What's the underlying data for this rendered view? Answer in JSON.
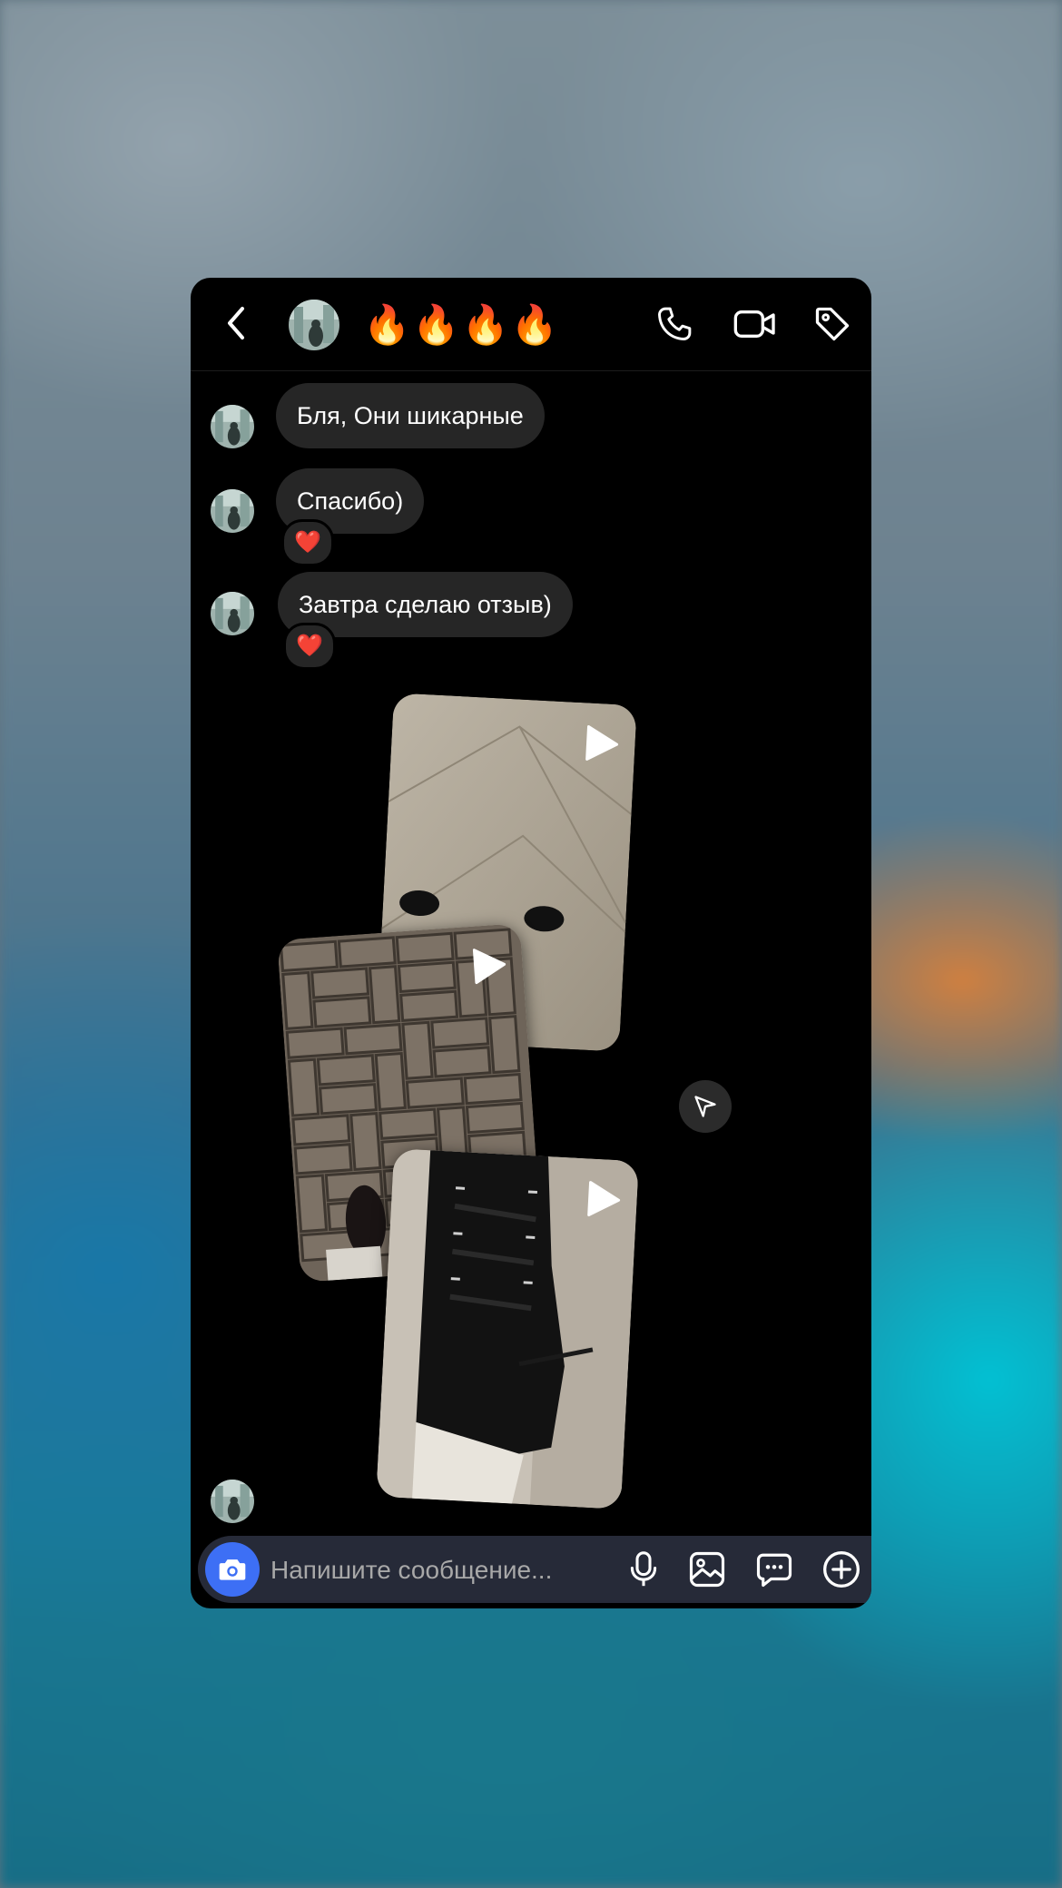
{
  "chat": {
    "title": "🔥🔥🔥🔥",
    "messages": [
      {
        "text": "Бля, Они шикарные"
      },
      {
        "text": "Спасибо)",
        "reaction": "❤️"
      },
      {
        "text": "Завтра сделаю отзыв)",
        "reaction": "❤️"
      }
    ]
  },
  "composer": {
    "placeholder": "Напишите сообщение..."
  },
  "icons": {
    "back": "chevron-left-icon",
    "call": "phone-icon",
    "video": "video-camera-icon",
    "tag": "tag-icon",
    "camera": "camera-icon",
    "mic": "microphone-icon",
    "gallery": "image-icon",
    "sticker": "message-bubble-icon",
    "add": "plus-circle-icon",
    "share": "send-icon",
    "play": "play-icon"
  },
  "colors": {
    "background": "#000000",
    "bubble": "#262626",
    "camera_button": "#3d6ff5",
    "composer": "#262a38",
    "reaction_heart": "#e0245e"
  }
}
